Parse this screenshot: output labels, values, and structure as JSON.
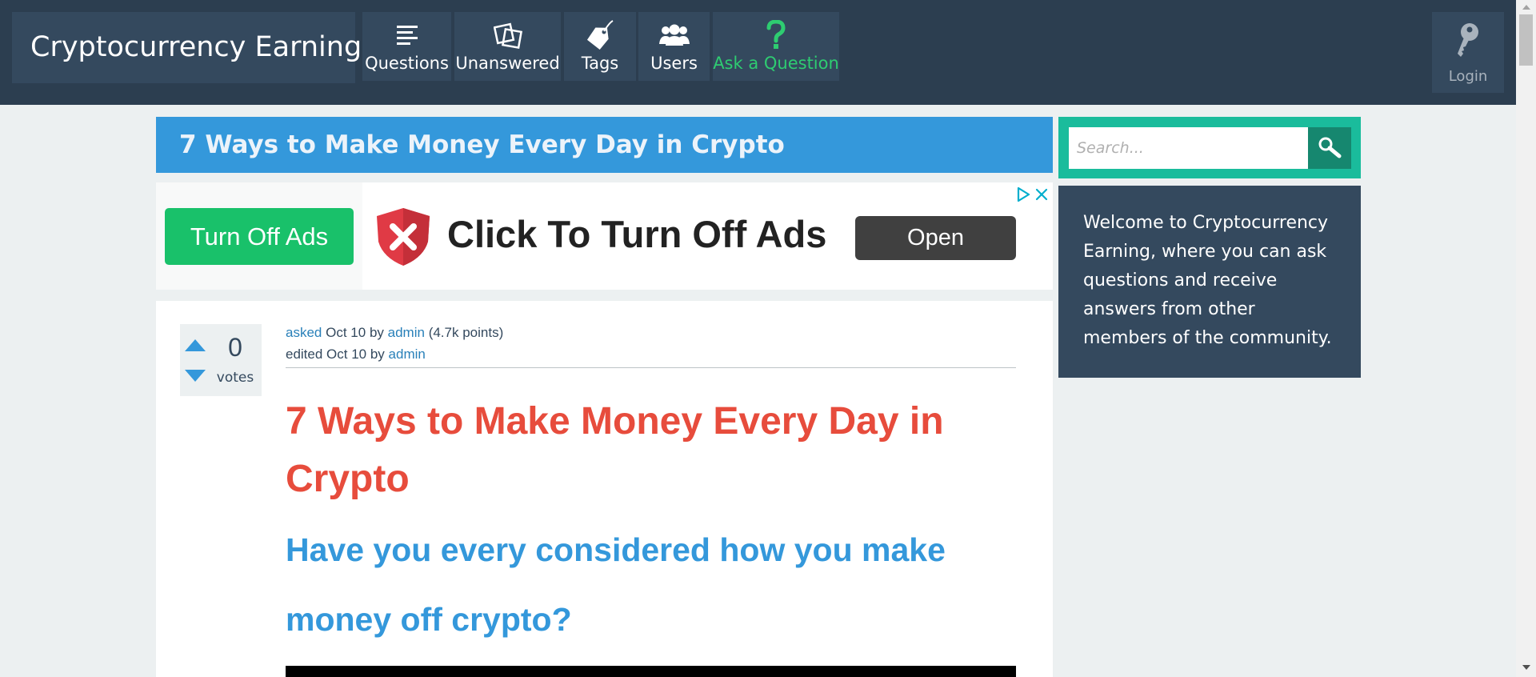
{
  "site": {
    "title": "Cryptocurrency Earning"
  },
  "nav": {
    "items": [
      {
        "label": "Questions",
        "icon": "questions-list-icon"
      },
      {
        "label": "Unanswered",
        "icon": "unanswered-squares-icon"
      },
      {
        "label": "Tags",
        "icon": "tag-icon"
      },
      {
        "label": "Users",
        "icon": "users-group-icon"
      },
      {
        "label": "Ask a Question",
        "icon": "question-mark-icon"
      }
    ],
    "login": {
      "label": "Login",
      "icon": "key-icon"
    },
    "ask_color": "#2ecc71"
  },
  "page": {
    "title": "7 Ways to Make Money Every Day in Crypto"
  },
  "ad": {
    "button_label": "Turn Off Ads",
    "headline": "Click To Turn Off Ads",
    "open_label": "Open",
    "shield_color": "#e03a45"
  },
  "question": {
    "votes": {
      "count": "0",
      "label": "votes"
    },
    "meta": {
      "asked_label": "asked",
      "asked_date": "Oct 10",
      "by_label": "by",
      "author": "admin",
      "points": "(4.7k points)",
      "edited_label": "edited Oct 10 by",
      "editor": "admin"
    },
    "heading": "7 Ways to Make Money Every Day in Crypto",
    "subheading": "Have you every considered how you make money off crypto?"
  },
  "sidebar": {
    "search": {
      "placeholder": "Search..."
    },
    "welcome": "Welcome to Cryptocurrency Earning, where you can ask questions and receive answers from other members of the community."
  },
  "colors": {
    "topbar": "#2c3e50",
    "title_bar": "#3498db",
    "heading": "#e74c3c",
    "search_bg": "#1abc9c"
  }
}
